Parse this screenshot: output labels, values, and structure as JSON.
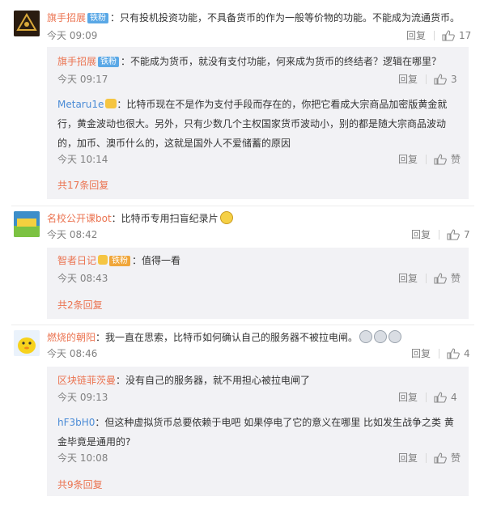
{
  "comments": [
    {
      "user": "旗手招展",
      "badge": "铁粉",
      "text": "：只有投机投资功能，不具备货币的作为一般等价物的功能。不能成为流通货币。",
      "time": "今天 09:09",
      "reply_label": "回复",
      "likes": "17",
      "replies": [
        {
          "user": "旗手招展",
          "badge": "铁粉",
          "text": "：不能成为货币，就没有支付功能，何来成为货币的终结者？逻辑在哪里？",
          "time": "今天 09:17",
          "reply_label": "回复",
          "likes": "3"
        },
        {
          "user": "Metaru1e",
          "text_lines": [
            "：比特币现在不是作为支付手段而存在的，你把它看成大宗商品加密版黄金就",
            "行，黄金波动也很大。另外，只有少数几个主权国家货币波动小，别的都是随大宗商品波动",
            "的，加币、澳币什么的，这就是国外人不爱储蓄的原因"
          ],
          "time": "今天 10:14",
          "reply_label": "回复",
          "likes": "赞"
        }
      ],
      "more": "共17条回复"
    },
    {
      "user": "名校公开课bot",
      "text": "：比特币专用扫盲纪录片",
      "time": "今天 08:42",
      "reply_label": "回复",
      "likes": "7",
      "replies": [
        {
          "user": "智者日记",
          "badge": "铁粉",
          "text": "：值得一看",
          "time": "今天 08:43",
          "reply_label": "回复",
          "likes": "赞"
        }
      ],
      "more": "共2条回复"
    },
    {
      "user": "燃烧的朝阳",
      "text": "：我一直在思索，比特币如何确认自己的服务器不被拉电闸。",
      "time": "今天 08:46",
      "reply_label": "回复",
      "likes": "4",
      "replies": [
        {
          "user": "区块链菲茨曼",
          "text": "：没有自己的服务器，就不用担心被拉电闸了",
          "time": "今天 09:13",
          "reply_label": "回复",
          "likes": "4"
        },
        {
          "user": "hF3bH0",
          "text_lines": [
            "：但这种虚拟货币总要依赖于电吧 如果停电了它的意义在哪里 比如发生战争之类 黄",
            "金毕竟是通用的?"
          ],
          "time": "今天 10:08",
          "reply_label": "回复",
          "likes": "赞"
        }
      ],
      "more": "共9条回复"
    }
  ],
  "icons": {
    "like": "thumbs-up-icon",
    "emoji_sunglasses": "sunglasses-emoji-icon",
    "emoji_shocked": "shocked-face-emoji-icon",
    "fan_badge": "crown-badge-icon"
  },
  "colors": {
    "username": "#eb7350",
    "sub_username": "#4a8bd6",
    "meta": "#808080",
    "reply_box": "#f2f2f5",
    "badge": "#5aa8e6"
  }
}
